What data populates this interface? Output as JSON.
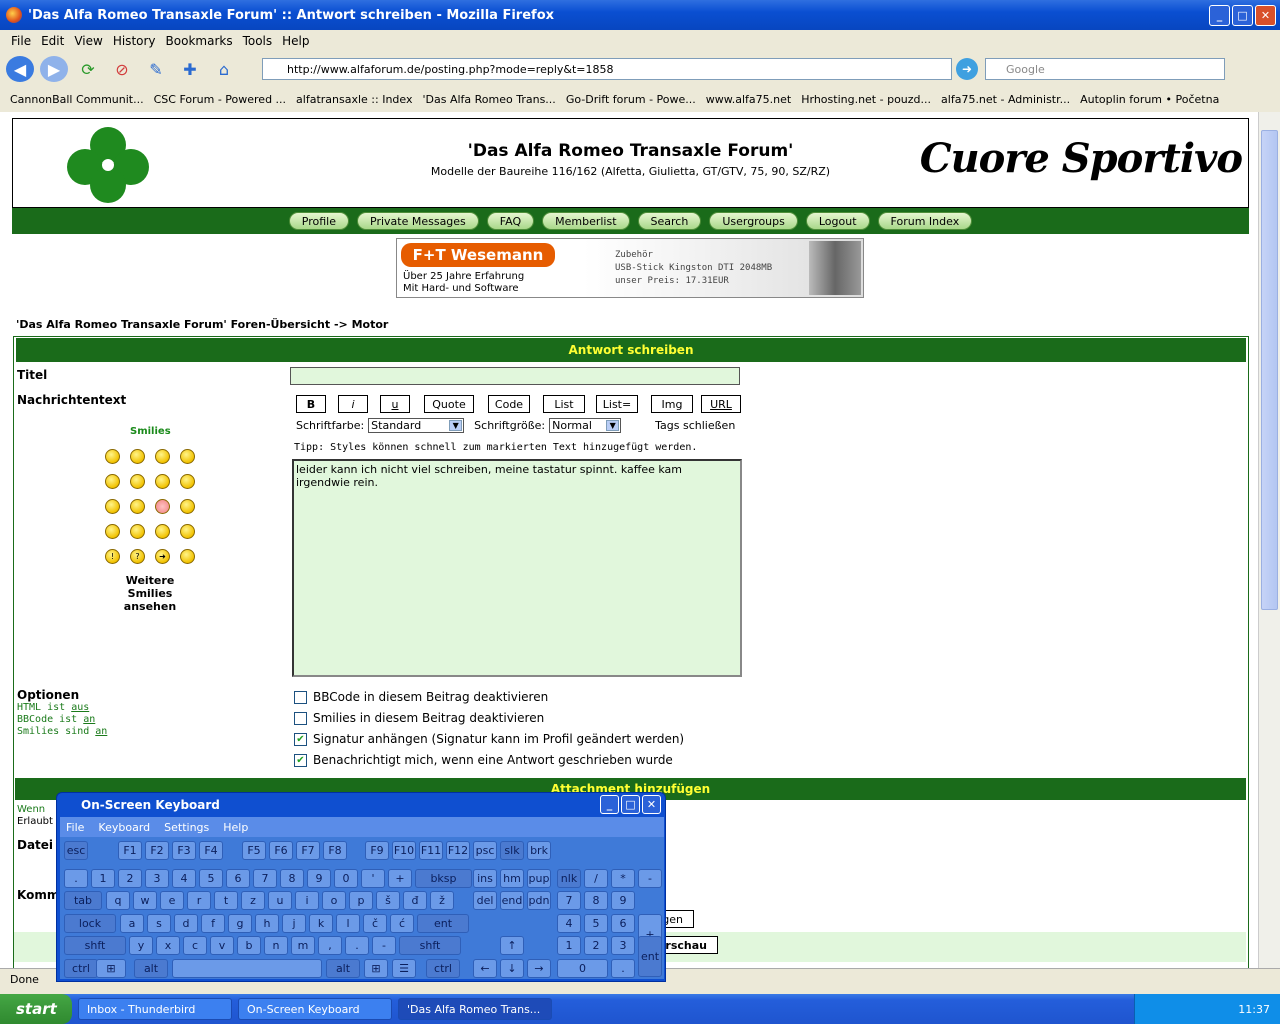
{
  "window": {
    "title": "'Das Alfa Romeo Transaxle Forum' :: Antwort schreiben - Mozilla Firefox"
  },
  "menu": [
    "File",
    "Edit",
    "View",
    "History",
    "Bookmarks",
    "Tools",
    "Help"
  ],
  "address": {
    "url": "http://www.alfaforum.de/posting.php?mode=reply&t=1858"
  },
  "search": {
    "placeholder": "Google"
  },
  "bookmarks": [
    "CannonBall Communit...",
    "CSC Forum - Powered ...",
    "alfatransaxle :: Index",
    "'Das Alfa Romeo Trans...",
    "Go-Drift forum - Powe...",
    "www.alfa75.net",
    "Hrhosting.net - pouzd...",
    "alfa75.net - Administr...",
    "Autoplin forum • Početna"
  ],
  "site": {
    "title": "'Das Alfa Romeo Transaxle Forum'",
    "subtitle": "Modelle der Baureihe 116/162 (Alfetta, Giulietta, GT/GTV, 75, 90, SZ/RZ)",
    "logo_text": "Cuore Sportivo",
    "nav": [
      "Profile",
      "Private Messages",
      "FAQ",
      "Memberlist",
      "Search",
      "Usergroups",
      "Logout",
      "Forum Index"
    ]
  },
  "banner": {
    "brand": "F+T Wesemann",
    "line1": "Über 25 Jahre Erfahrung",
    "line2": "Mit Hard- und Software",
    "right1": "Zubehör",
    "right2": "USB-Stick Kingston DTI 2048MB",
    "right3": "unser Preis: 17.31EUR"
  },
  "breadcrumb": "'Das Alfa Romeo Transaxle Forum' Foren-Übersicht -> Motor",
  "form": {
    "header": "Antwort schreiben",
    "titel_label": "Titel",
    "msg_label": "Nachrichtentext",
    "bbcode_buttons": [
      "B",
      "i",
      "u",
      "Quote",
      "Code",
      "List",
      "List=",
      "Img",
      "URL"
    ],
    "font_color_label": "Schriftfarbe:",
    "font_color_value": "Standard",
    "font_size_label": "Schriftgröße:",
    "font_size_value": "Normal",
    "close_tags": "Tags schließen",
    "tip": "Tipp: Styles können schnell zum markierten Text hinzugefügt werden.",
    "message": "leider kann ich nicht viel schreiben, meine tastatur spinnt. kaffee kam irgendwie rein.",
    "smilies_title": "Smilies",
    "more_smilies": "Weitere Smilies ansehen",
    "options_title": "Optionen",
    "html_status": [
      "HTML ist ",
      "aus"
    ],
    "bbcode_status": [
      "BBCode ist ",
      "an"
    ],
    "smilies_status": [
      "Smilies sind ",
      "an"
    ],
    "options": [
      {
        "label": "BBCode in diesem Beitrag deaktivieren",
        "checked": false
      },
      {
        "label": "Smilies in diesem Beitrag deaktivieren",
        "checked": false
      },
      {
        "label": "Signatur anhängen (Signatur kann im Profil geändert werden)",
        "checked": true
      },
      {
        "label": "Benachrichtigt mich, wenn eine Antwort geschrieben wurde",
        "checked": true
      }
    ],
    "attachment_header": "Attachment hinzufügen",
    "left_clip": [
      "Wenn",
      "Erlaubt",
      "Datei",
      "Komm"
    ],
    "partial_buttons": [
      "gen",
      "rschau"
    ]
  },
  "status": "Done",
  "osk": {
    "title": "On-Screen Keyboard",
    "menu": [
      "File",
      "Keyboard",
      "Settings",
      "Help"
    ],
    "row0": [
      "esc",
      "F1",
      "F2",
      "F3",
      "F4",
      "F5",
      "F6",
      "F7",
      "F8",
      "F9",
      "F10",
      "F11",
      "F12",
      "psc",
      "slk",
      "brk"
    ],
    "row1": [
      ".",
      "1",
      "2",
      "3",
      "4",
      "5",
      "6",
      "7",
      "8",
      "9",
      "0",
      "'",
      "+",
      "bksp",
      "ins",
      "hm",
      "pup",
      "nlk",
      "/",
      "*",
      "-"
    ],
    "row2": [
      "tab",
      "q",
      "w",
      "e",
      "r",
      "t",
      "z",
      "u",
      "i",
      "o",
      "p",
      "š",
      "đ",
      "ž",
      "del",
      "end",
      "pdn",
      "7",
      "8",
      "9"
    ],
    "row3": [
      "lock",
      "a",
      "s",
      "d",
      "f",
      "g",
      "h",
      "j",
      "k",
      "l",
      "č",
      "ć",
      "ent",
      "4",
      "5",
      "6",
      "+"
    ],
    "row4": [
      "shft",
      "y",
      "x",
      "c",
      "v",
      "b",
      "n",
      "m",
      ",",
      ".",
      "-",
      "shft",
      "1",
      "2",
      "3"
    ],
    "row5": [
      "ctrl",
      "alt",
      "alt",
      "ctrl",
      "0",
      ".",
      "ent"
    ]
  },
  "taskbar": {
    "start": "start",
    "items": [
      "Inbox - Thunderbird",
      "On-Screen Keyboard",
      "'Das Alfa Romeo Trans..."
    ],
    "clock": "11:37"
  }
}
